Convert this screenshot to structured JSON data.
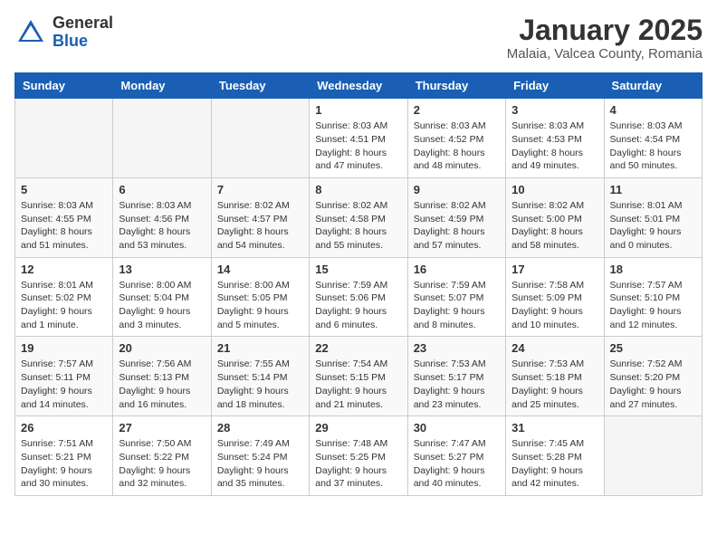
{
  "header": {
    "logo_general": "General",
    "logo_blue": "Blue",
    "month": "January 2025",
    "location": "Malaia, Valcea County, Romania"
  },
  "days_of_week": [
    "Sunday",
    "Monday",
    "Tuesday",
    "Wednesday",
    "Thursday",
    "Friday",
    "Saturday"
  ],
  "weeks": [
    [
      {
        "day": "",
        "info": ""
      },
      {
        "day": "",
        "info": ""
      },
      {
        "day": "",
        "info": ""
      },
      {
        "day": "1",
        "info": "Sunrise: 8:03 AM\nSunset: 4:51 PM\nDaylight: 8 hours and 47 minutes."
      },
      {
        "day": "2",
        "info": "Sunrise: 8:03 AM\nSunset: 4:52 PM\nDaylight: 8 hours and 48 minutes."
      },
      {
        "day": "3",
        "info": "Sunrise: 8:03 AM\nSunset: 4:53 PM\nDaylight: 8 hours and 49 minutes."
      },
      {
        "day": "4",
        "info": "Sunrise: 8:03 AM\nSunset: 4:54 PM\nDaylight: 8 hours and 50 minutes."
      }
    ],
    [
      {
        "day": "5",
        "info": "Sunrise: 8:03 AM\nSunset: 4:55 PM\nDaylight: 8 hours and 51 minutes."
      },
      {
        "day": "6",
        "info": "Sunrise: 8:03 AM\nSunset: 4:56 PM\nDaylight: 8 hours and 53 minutes."
      },
      {
        "day": "7",
        "info": "Sunrise: 8:02 AM\nSunset: 4:57 PM\nDaylight: 8 hours and 54 minutes."
      },
      {
        "day": "8",
        "info": "Sunrise: 8:02 AM\nSunset: 4:58 PM\nDaylight: 8 hours and 55 minutes."
      },
      {
        "day": "9",
        "info": "Sunrise: 8:02 AM\nSunset: 4:59 PM\nDaylight: 8 hours and 57 minutes."
      },
      {
        "day": "10",
        "info": "Sunrise: 8:02 AM\nSunset: 5:00 PM\nDaylight: 8 hours and 58 minutes."
      },
      {
        "day": "11",
        "info": "Sunrise: 8:01 AM\nSunset: 5:01 PM\nDaylight: 9 hours and 0 minutes."
      }
    ],
    [
      {
        "day": "12",
        "info": "Sunrise: 8:01 AM\nSunset: 5:02 PM\nDaylight: 9 hours and 1 minute."
      },
      {
        "day": "13",
        "info": "Sunrise: 8:00 AM\nSunset: 5:04 PM\nDaylight: 9 hours and 3 minutes."
      },
      {
        "day": "14",
        "info": "Sunrise: 8:00 AM\nSunset: 5:05 PM\nDaylight: 9 hours and 5 minutes."
      },
      {
        "day": "15",
        "info": "Sunrise: 7:59 AM\nSunset: 5:06 PM\nDaylight: 9 hours and 6 minutes."
      },
      {
        "day": "16",
        "info": "Sunrise: 7:59 AM\nSunset: 5:07 PM\nDaylight: 9 hours and 8 minutes."
      },
      {
        "day": "17",
        "info": "Sunrise: 7:58 AM\nSunset: 5:09 PM\nDaylight: 9 hours and 10 minutes."
      },
      {
        "day": "18",
        "info": "Sunrise: 7:57 AM\nSunset: 5:10 PM\nDaylight: 9 hours and 12 minutes."
      }
    ],
    [
      {
        "day": "19",
        "info": "Sunrise: 7:57 AM\nSunset: 5:11 PM\nDaylight: 9 hours and 14 minutes."
      },
      {
        "day": "20",
        "info": "Sunrise: 7:56 AM\nSunset: 5:13 PM\nDaylight: 9 hours and 16 minutes."
      },
      {
        "day": "21",
        "info": "Sunrise: 7:55 AM\nSunset: 5:14 PM\nDaylight: 9 hours and 18 minutes."
      },
      {
        "day": "22",
        "info": "Sunrise: 7:54 AM\nSunset: 5:15 PM\nDaylight: 9 hours and 21 minutes."
      },
      {
        "day": "23",
        "info": "Sunrise: 7:53 AM\nSunset: 5:17 PM\nDaylight: 9 hours and 23 minutes."
      },
      {
        "day": "24",
        "info": "Sunrise: 7:53 AM\nSunset: 5:18 PM\nDaylight: 9 hours and 25 minutes."
      },
      {
        "day": "25",
        "info": "Sunrise: 7:52 AM\nSunset: 5:20 PM\nDaylight: 9 hours and 27 minutes."
      }
    ],
    [
      {
        "day": "26",
        "info": "Sunrise: 7:51 AM\nSunset: 5:21 PM\nDaylight: 9 hours and 30 minutes."
      },
      {
        "day": "27",
        "info": "Sunrise: 7:50 AM\nSunset: 5:22 PM\nDaylight: 9 hours and 32 minutes."
      },
      {
        "day": "28",
        "info": "Sunrise: 7:49 AM\nSunset: 5:24 PM\nDaylight: 9 hours and 35 minutes."
      },
      {
        "day": "29",
        "info": "Sunrise: 7:48 AM\nSunset: 5:25 PM\nDaylight: 9 hours and 37 minutes."
      },
      {
        "day": "30",
        "info": "Sunrise: 7:47 AM\nSunset: 5:27 PM\nDaylight: 9 hours and 40 minutes."
      },
      {
        "day": "31",
        "info": "Sunrise: 7:45 AM\nSunset: 5:28 PM\nDaylight: 9 hours and 42 minutes."
      },
      {
        "day": "",
        "info": ""
      }
    ]
  ]
}
